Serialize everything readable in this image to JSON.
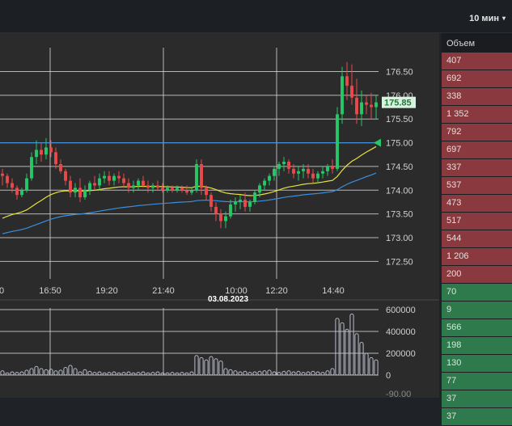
{
  "header": {
    "timeframe_label": "10 мин",
    "caret": "▾"
  },
  "volume_panel": {
    "header": "Объем",
    "rows": [
      {
        "value": "407",
        "side": "sell"
      },
      {
        "value": "692",
        "side": "sell"
      },
      {
        "value": "338",
        "side": "sell"
      },
      {
        "value": "1 352",
        "side": "sell"
      },
      {
        "value": "792",
        "side": "sell"
      },
      {
        "value": "697",
        "side": "sell"
      },
      {
        "value": "337",
        "side": "sell"
      },
      {
        "value": "537",
        "side": "sell"
      },
      {
        "value": "473",
        "side": "sell"
      },
      {
        "value": "517",
        "side": "sell"
      },
      {
        "value": "544",
        "side": "sell"
      },
      {
        "value": "1 206",
        "side": "sell"
      },
      {
        "value": "200",
        "side": "sell"
      },
      {
        "value": "70",
        "side": "buy"
      },
      {
        "value": "9",
        "side": "buy"
      },
      {
        "value": "566",
        "side": "buy"
      },
      {
        "value": "198",
        "side": "buy"
      },
      {
        "value": "130",
        "side": "buy"
      },
      {
        "value": "77",
        "side": "buy"
      },
      {
        "value": "37",
        "side": "buy"
      },
      {
        "value": "37",
        "side": "buy"
      }
    ]
  },
  "colors": {
    "up": "#26c766",
    "down": "#e84a4a",
    "ma_fast": "#e8e23a",
    "ma_slow": "#3a8fe0",
    "grid": "#d0d0d0",
    "price_line": "#3a8fe0",
    "price_badge_bg": "#d9f2df",
    "price_badge_text": "#1d7a3a",
    "volume": "#b8bccc",
    "sell_row": "#8a3a3e",
    "buy_row": "#2e7a4c"
  },
  "chart_data": {
    "type": "candlestick",
    "price_axis": {
      "ticks": [
        176.5,
        176.0,
        175.5,
        175.0,
        174.5,
        174.0,
        173.5,
        173.0,
        172.5
      ],
      "tick_labels": [
        "176.50",
        "176.00",
        "175.50",
        "175.00",
        "174.50",
        "174.00",
        "173.50",
        "173.00",
        "172.50"
      ],
      "ylim": [
        172.2,
        176.9
      ]
    },
    "volume_axis": {
      "ticks": [
        600000,
        400000,
        200000,
        0
      ],
      "tick_labels": [
        "600000",
        "400000",
        "200000",
        "0"
      ],
      "ylim": [
        0,
        600000
      ]
    },
    "time_axis": {
      "tick_labels": [
        "0",
        "16:50",
        "19:20",
        "21:40",
        "10:00",
        "12:20",
        "14:40"
      ],
      "date_label": "03.08.2023",
      "n_bars": 78
    },
    "last_price": 175.85,
    "last_price_label": "175.85",
    "marker_price": 175.0,
    "bar_axis_below_label": "-90.00",
    "ohlc": [
      [
        174.35,
        174.45,
        174.1,
        174.3
      ],
      [
        174.3,
        174.35,
        174.05,
        174.15
      ],
      [
        174.15,
        174.25,
        173.95,
        174.05
      ],
      [
        174.05,
        174.1,
        173.8,
        173.9
      ],
      [
        173.9,
        174.05,
        173.85,
        174.0
      ],
      [
        174.0,
        174.35,
        173.95,
        174.25
      ],
      [
        174.25,
        174.8,
        174.2,
        174.7
      ],
      [
        174.7,
        175.05,
        174.55,
        174.85
      ],
      [
        174.85,
        175.0,
        174.6,
        174.75
      ],
      [
        174.75,
        175.1,
        174.65,
        174.9
      ],
      [
        174.9,
        175.05,
        174.7,
        174.8
      ],
      [
        174.8,
        174.9,
        174.45,
        174.55
      ],
      [
        174.55,
        174.65,
        174.35,
        174.4
      ],
      [
        174.4,
        174.45,
        174.1,
        174.2
      ],
      [
        174.2,
        174.3,
        173.85,
        173.95
      ],
      [
        173.95,
        174.15,
        173.85,
        174.05
      ],
      [
        174.05,
        174.25,
        173.75,
        173.85
      ],
      [
        173.85,
        174.1,
        173.8,
        174.0
      ],
      [
        174.0,
        174.2,
        173.9,
        174.15
      ],
      [
        174.15,
        174.3,
        174.0,
        174.1
      ],
      [
        174.1,
        174.35,
        174.0,
        174.25
      ],
      [
        174.25,
        174.4,
        174.15,
        174.3
      ],
      [
        174.3,
        174.4,
        174.1,
        174.2
      ],
      [
        174.2,
        174.35,
        174.1,
        174.3
      ],
      [
        174.3,
        174.4,
        174.15,
        174.25
      ],
      [
        174.25,
        174.35,
        174.05,
        174.15
      ],
      [
        174.15,
        174.25,
        173.95,
        174.05
      ],
      [
        174.05,
        174.2,
        173.95,
        174.1
      ],
      [
        174.1,
        174.25,
        174.0,
        174.2
      ],
      [
        174.2,
        174.3,
        174.05,
        174.1
      ],
      [
        174.1,
        174.2,
        173.95,
        174.05
      ],
      [
        174.05,
        174.15,
        173.95,
        174.1
      ],
      [
        174.1,
        174.2,
        174.0,
        174.05
      ],
      [
        174.05,
        174.15,
        173.95,
        174.0
      ],
      [
        174.0,
        174.1,
        173.95,
        174.05
      ],
      [
        174.05,
        174.1,
        173.95,
        174.0
      ],
      [
        174.0,
        174.1,
        173.95,
        174.05
      ],
      [
        174.05,
        174.1,
        173.95,
        174.0
      ],
      [
        174.0,
        174.1,
        173.9,
        173.95
      ],
      [
        173.95,
        174.05,
        173.9,
        174.0
      ],
      [
        174.0,
        174.65,
        173.95,
        174.55
      ],
      [
        174.55,
        174.65,
        173.9,
        174.05
      ],
      [
        174.05,
        174.1,
        173.8,
        173.9
      ],
      [
        173.9,
        173.95,
        173.55,
        173.65
      ],
      [
        173.65,
        173.75,
        173.35,
        173.5
      ],
      [
        173.5,
        173.6,
        173.2,
        173.35
      ],
      [
        173.35,
        173.55,
        173.2,
        173.45
      ],
      [
        173.45,
        173.8,
        173.4,
        173.7
      ],
      [
        173.7,
        173.85,
        173.55,
        173.75
      ],
      [
        173.75,
        173.9,
        173.6,
        173.8
      ],
      [
        173.8,
        173.95,
        173.55,
        173.65
      ],
      [
        173.65,
        173.8,
        173.55,
        173.75
      ],
      [
        173.75,
        174.0,
        173.7,
        173.95
      ],
      [
        173.95,
        174.15,
        173.85,
        174.1
      ],
      [
        174.1,
        174.25,
        174.0,
        174.2
      ],
      [
        174.2,
        174.35,
        174.1,
        174.3
      ],
      [
        174.3,
        174.5,
        174.2,
        174.45
      ],
      [
        174.45,
        174.6,
        174.3,
        174.55
      ],
      [
        174.55,
        174.7,
        174.4,
        174.6
      ],
      [
        174.6,
        174.65,
        174.35,
        174.45
      ],
      [
        174.45,
        174.55,
        174.25,
        174.35
      ],
      [
        174.35,
        174.5,
        174.2,
        174.4
      ],
      [
        174.4,
        174.55,
        174.25,
        174.45
      ],
      [
        174.45,
        174.55,
        174.25,
        174.35
      ],
      [
        174.35,
        174.45,
        174.15,
        174.25
      ],
      [
        174.25,
        174.4,
        174.15,
        174.35
      ],
      [
        174.35,
        174.5,
        174.25,
        174.4
      ],
      [
        174.4,
        174.55,
        174.3,
        174.5
      ],
      [
        174.5,
        174.65,
        174.35,
        174.45
      ],
      [
        174.45,
        175.75,
        174.4,
        175.6
      ],
      [
        175.6,
        176.6,
        175.4,
        176.4
      ],
      [
        176.4,
        176.7,
        175.9,
        176.2
      ],
      [
        176.2,
        176.65,
        175.8,
        175.95
      ],
      [
        175.95,
        176.35,
        175.4,
        175.6
      ],
      [
        175.6,
        176.1,
        175.35,
        175.85
      ],
      [
        175.85,
        176.0,
        175.6,
        175.8
      ],
      [
        175.8,
        176.05,
        175.5,
        175.75
      ],
      [
        175.75,
        176.0,
        175.5,
        175.85
      ]
    ],
    "volume": [
      40,
      20,
      30,
      25,
      30,
      45,
      60,
      80,
      60,
      50,
      55,
      40,
      45,
      70,
      90,
      60,
      30,
      50,
      35,
      25,
      30,
      20,
      25,
      30,
      20,
      25,
      30,
      20,
      25,
      30,
      20,
      25,
      30,
      20,
      20,
      25,
      20,
      25,
      20,
      30,
      180,
      160,
      140,
      170,
      150,
      130,
      60,
      50,
      40,
      30,
      35,
      25,
      30,
      35,
      40,
      45,
      30,
      25,
      35,
      40,
      30,
      35,
      25,
      30,
      35,
      30,
      25,
      40,
      60,
      520,
      480,
      420,
      560,
      380,
      300,
      200,
      160,
      140
    ]
  }
}
